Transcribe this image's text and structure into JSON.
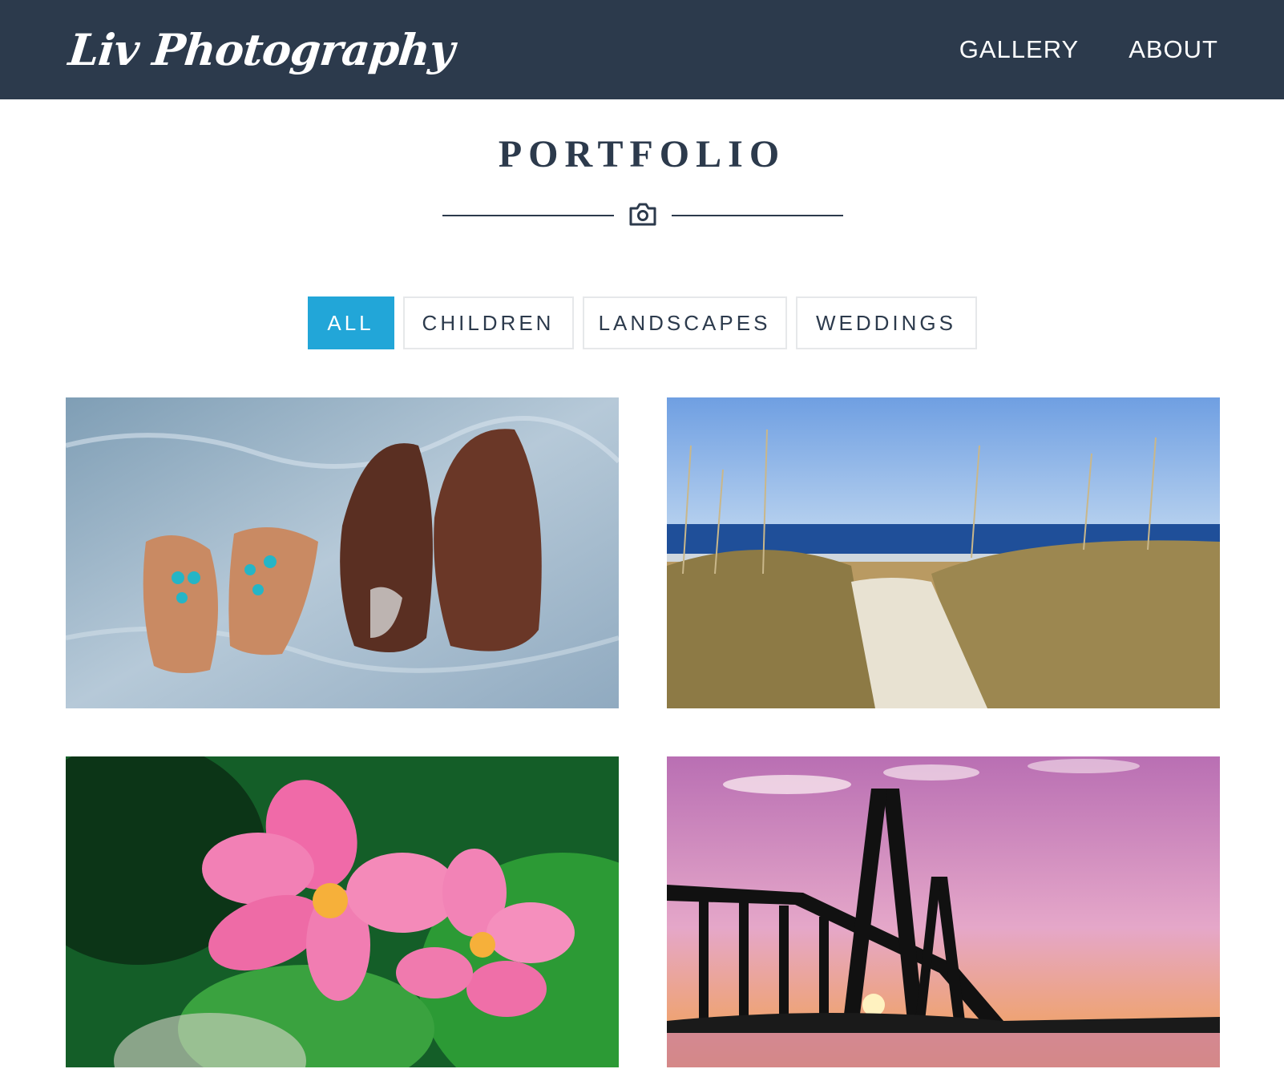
{
  "header": {
    "brand": "Liv Photography",
    "nav": [
      {
        "label": "GALLERY"
      },
      {
        "label": "ABOUT"
      }
    ]
  },
  "main": {
    "title": "PORTFOLIO",
    "divider_icon": "camera-icon",
    "filters": [
      {
        "label": "ALL",
        "active": true
      },
      {
        "label": "CHILDREN",
        "active": false
      },
      {
        "label": "LANDSCAPES",
        "active": false
      },
      {
        "label": "WEDDINGS",
        "active": false
      }
    ],
    "gallery": [
      {
        "subject": "sandals-and-shoes-on-sand"
      },
      {
        "subject": "beach-dune-path"
      },
      {
        "subject": "pink-plumeria-flowers"
      },
      {
        "subject": "bridge-at-sunset"
      }
    ]
  },
  "colors": {
    "navbar": "#2c3a4c",
    "accent": "#22a6d8",
    "text": "#2c3a4c"
  }
}
